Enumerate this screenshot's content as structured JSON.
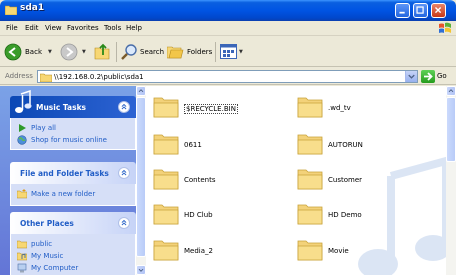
{
  "window": {
    "title": "sda1"
  },
  "menu": [
    "File",
    "Edit",
    "View",
    "Favorites",
    "Tools",
    "Help"
  ],
  "toolbar": {
    "back_label": "Back",
    "search_label": "Search",
    "folders_label": "Folders"
  },
  "address": {
    "label": "Address",
    "value": "\\\\192.168.0.2\\public\\sda1",
    "go_label": "Go"
  },
  "tasks": {
    "music": {
      "title": "Music Tasks",
      "items": [
        "Play all",
        "Shop for music online"
      ]
    },
    "file_folder": {
      "title": "File and Folder Tasks",
      "items": [
        "Make a new folder"
      ]
    },
    "other_places": {
      "title": "Other Places",
      "items": [
        "public",
        "My Music",
        "My Computer"
      ]
    }
  },
  "folders": [
    "$RECYCLE.BIN",
    ".wd_tv",
    "0611",
    "AUTORUN",
    "Contents",
    "Customer",
    "HD Club",
    "HD Demo",
    "Media_2",
    "Movie"
  ],
  "colors": {
    "titlebar": "#0054e3",
    "taskpane": "#6f8fe0",
    "task_link": "#215dc6",
    "folder": "#f2d675"
  }
}
